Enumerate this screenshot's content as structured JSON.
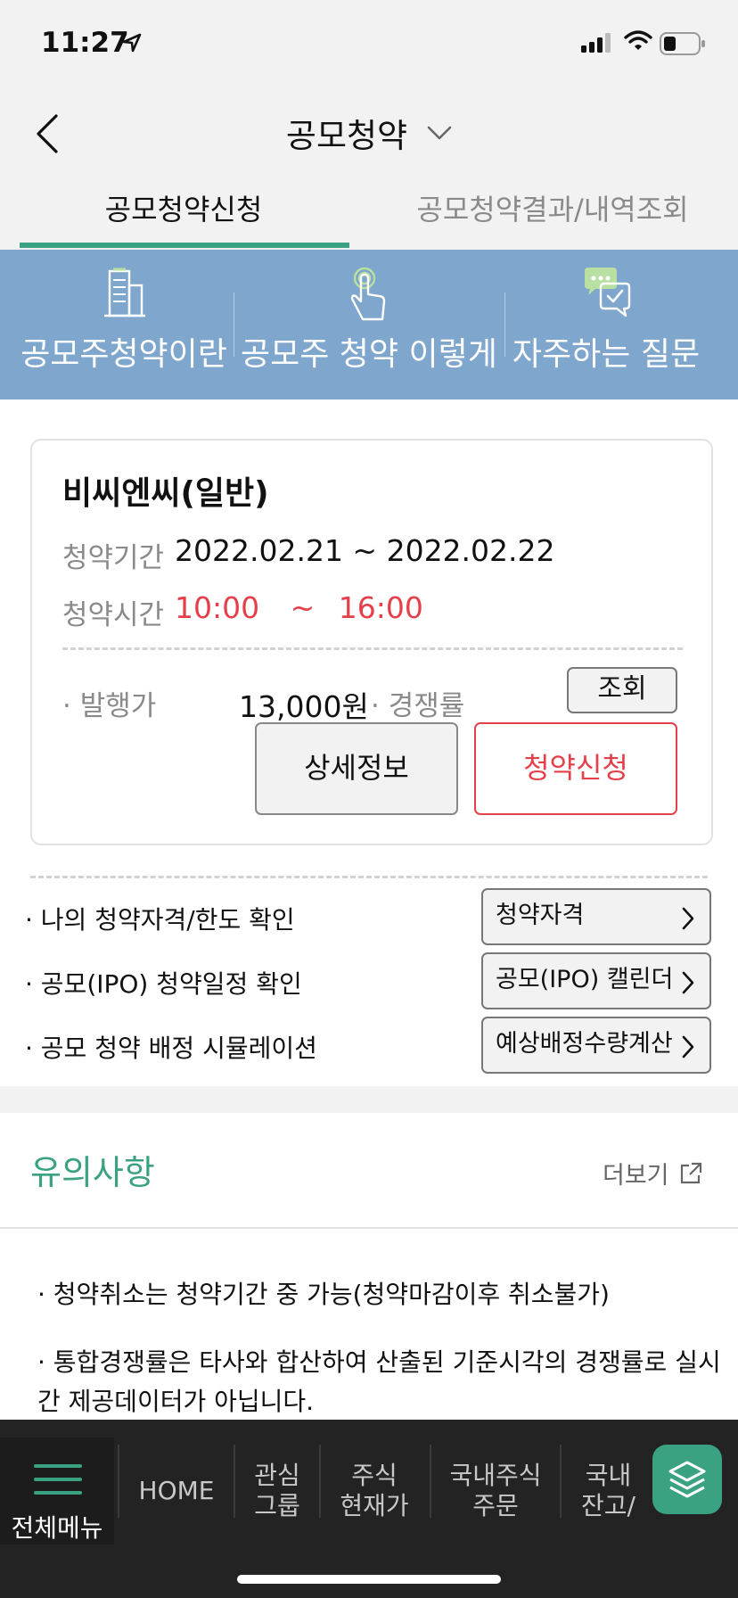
{
  "status_bar": {
    "time": "11:27"
  },
  "header": {
    "title": "공모청약"
  },
  "tabs": [
    {
      "label": "공모청약신청",
      "active": true
    },
    {
      "label": "공모청약결과/내역조회",
      "active": false
    }
  ],
  "banner": {
    "items": [
      {
        "label": "공모주청약이란",
        "icon": "building-icon"
      },
      {
        "label": "공모주 청약 이렇게",
        "icon": "finger-tap-icon"
      },
      {
        "label": "자주하는 질문",
        "icon": "chat-check-icon"
      }
    ]
  },
  "offering": {
    "name": "비씨엔씨(일반)",
    "period_label": "청약기간",
    "period_value": "2022.02.21 ~ 2022.02.22",
    "time_label": "청약시간",
    "time_start": "10:00",
    "time_sep": "~",
    "time_end": "16:00",
    "issue_label": "· 발행가",
    "issue_price": "13,000원",
    "competition_label": "· 경쟁률",
    "query_button": "조회",
    "detail_button": "상세정보",
    "apply_button": "청약신청"
  },
  "links": [
    {
      "text": "·  나의 청약자격/한도 확인",
      "button": "청약자격"
    },
    {
      "text": "·  공모(IPO) 청약일정 확인",
      "button": "공모(IPO) 캘린더"
    },
    {
      "text": "·  공모 청약 배정 시뮬레이션",
      "button": "예상배정수량계산"
    }
  ],
  "notice": {
    "title": "유의사항",
    "more_label": "더보기",
    "items": [
      "· 청약취소는 청약기간 중 가능(청약마감이후 취소불가)",
      "· 통합경쟁률은 타사와 합산하여 산출된 기준시각의 경쟁률로 실시간 제공데이터가 아닙니다."
    ]
  },
  "bottom_nav": {
    "menu_label": "전체메뉴",
    "items": [
      "HOME",
      "관심\n그룹",
      "주식\n현재가",
      "국내주식\n주문",
      "국내\n잔고/"
    ]
  },
  "colors": {
    "accent_green": "#3aa282",
    "banner_blue": "#7fa6cc",
    "alert_red": "#e5404a",
    "nav_dark": "#232323"
  }
}
